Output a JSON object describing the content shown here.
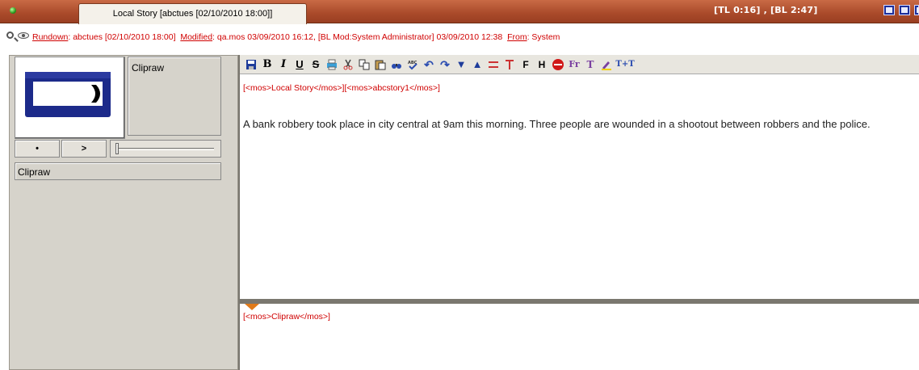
{
  "titlebar": {
    "tab_title": "Local Story [abctues [02/10/2010 18:00]]",
    "timecode": "[TL 0:16] , [BL 2:47]"
  },
  "info": {
    "rundown_label": "Rundown",
    "rundown_value": "abctues [02/10/2010 18:00]",
    "modified_label": "Modified",
    "modified_value": "qa.mos  03/09/2010 16:12, [BL Mod:System Administrator]  03/09/2010 12:38",
    "from_label": "From",
    "from_value": "System"
  },
  "clip": {
    "name": "Clipraw",
    "label": "Clipraw",
    "stop_button": "•",
    "play_button": ">"
  },
  "toolbar": {
    "icons": [
      "save-icon",
      "bold-icon",
      "italic-icon",
      "underline-icon",
      "strikethrough-icon",
      "print-icon",
      "cut-icon",
      "copy-icon",
      "paste-icon",
      "find-icon",
      "spellcheck-icon",
      "undo-icon",
      "redo-icon",
      "move-down-icon",
      "move-up-icon",
      "insert-line-icon",
      "text-cursor-icon",
      "insert-f-icon",
      "insert-h-icon",
      "no-entry-icon",
      "font-icon",
      "text-color-icon",
      "highlight-icon",
      "text-size-icon"
    ],
    "bold": "B",
    "italic": "I",
    "underline": "U",
    "strike": "S",
    "font": "Fr",
    "textsize": "T+T",
    "ins_f": "F",
    "ins_h": "H"
  },
  "editor": {
    "mos_top": "[<mos>Local Story</mos>][<mos>abcstory1</mos>]",
    "story_body": "A bank robbery took place in city central at 9am this morning. Three people are wounded in a shootout between robbers and the police.",
    "mos_bottom": "[<mos>Clipraw</mos>]"
  },
  "colors": {
    "titlebar": "#a94a2a",
    "accent_red": "#d00000",
    "panel_gray": "#d6d3cb",
    "tape_blue": "#1c2a8a"
  }
}
